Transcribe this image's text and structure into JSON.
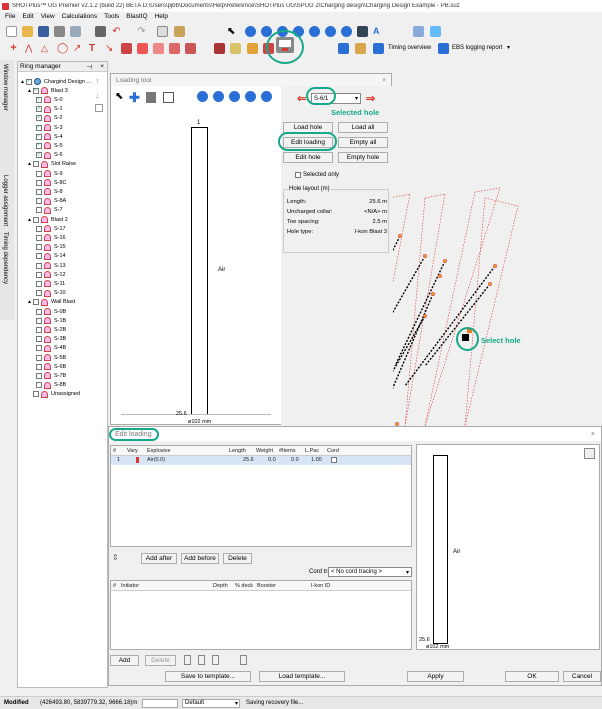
{
  "title_bar": "SHOTPlus™ UG Premier v2.1.2 (build 22) BETA D:\\Users\\pjbb\\Documents\\Help\\Reference\\SHOTPlus UG\\SPUG 2\\Charging design\\Charging Design Example - PB.suz",
  "menu": [
    "File",
    "Edit",
    "View",
    "Calculations",
    "Tools",
    "BlastIQ",
    "Help"
  ],
  "toolbar": {
    "timing_overview": "Timing overview",
    "ebs_report": "EBS logging report"
  },
  "side_tabs": [
    "Window manager",
    "Logger assignment",
    "Timing dependency"
  ],
  "ring_manager": {
    "title": "Ring manager",
    "root": "Chargind Design ...",
    "groups": [
      {
        "name": "Blast 3",
        "checked": true,
        "holes": [
          "S-0",
          "S-1",
          "S-2",
          "S-3",
          "S-4",
          "S-5",
          "S-6"
        ],
        "checked_holes": true
      },
      {
        "name": "Slot Raise",
        "checked": false,
        "holes": [
          "S-9",
          "S-8C",
          "S-8",
          "S-8A",
          "S-7"
        ],
        "checked_holes": false
      },
      {
        "name": "Blast 2",
        "checked": false,
        "holes": [
          "S-17",
          "S-16",
          "S-15",
          "S-14",
          "S-13",
          "S-12",
          "S-11",
          "S-10"
        ],
        "checked_holes": false
      },
      {
        "name": "Wall Blast",
        "checked": false,
        "holes": [
          "S-0B",
          "S-1B",
          "S-2B",
          "S-3B",
          "S-4B",
          "S-5B",
          "S-6B",
          "S-7B",
          "S-8B"
        ],
        "checked_holes": false
      }
    ],
    "unassigned": "Unassigned"
  },
  "loading_tool": {
    "title": "Loading tool",
    "hole_select": "S-6/1",
    "buttons": {
      "load_hole": "Load hole",
      "load_all": "Load all",
      "edit_loading": "Edit loading",
      "empty_all": "Empty all",
      "edit_hole": "Edit hole",
      "empty_hole": "Empty hole"
    },
    "selected_only": "Selected only",
    "layout_title": "Hole layout (m)",
    "layout": [
      {
        "label": "Length:",
        "value": "25.6  m"
      },
      {
        "label": "Uncharged collar:",
        "value": "<N/A>  m"
      },
      {
        "label": "Toe spacing:",
        "value": "2.5  m"
      },
      {
        "label": "Hole type:",
        "value": "I-kon Blast 3"
      }
    ],
    "hole_top_label": "1",
    "fill_label": "Air",
    "depth_label": "25.6",
    "diameter_label": "ø102 mm"
  },
  "annotations": {
    "selected_hole": "Selected hole",
    "select_hole": "Select hole"
  },
  "edit_loading": {
    "title": "Edit loading",
    "columns": [
      "#",
      "Vary",
      "Explosive",
      "Length",
      "Weight",
      "#Items",
      "L.Pac",
      "Cord"
    ],
    "rows": [
      {
        "n": "1",
        "explosive": "Air(0.0)",
        "length": "25.6",
        "weight": "0.0",
        "items": "0.0",
        "lpac": "1.00"
      }
    ],
    "add_after": "Add after",
    "add_before": "Add before",
    "delete": "Delete",
    "cord_tracing_label": "Cord tracing",
    "cord_tracing_value": "< No cord tracing >",
    "init_columns": [
      "#",
      "Initiator",
      "Depth",
      "% deck",
      "Booster",
      "I-kon ID"
    ],
    "add": "Add",
    "delete2": "Delete",
    "save_template": "Save to template...",
    "load_template": "Load template...",
    "apply": "Apply",
    "ok": "OK",
    "cancel": "Cancel",
    "preview_fill": "Air",
    "preview_depth": "25.6",
    "preview_diameter": "ø102 mm"
  },
  "status": {
    "mode": "Modified",
    "coords": "(426493.80, 5839779.32, 9666.18)m",
    "layer": "Default",
    "message": "Saving recovery file..."
  },
  "colors": {
    "accent": "#17a88a",
    "blue_icon": "#2a6fd6",
    "red_arrow": "#d23b2b"
  }
}
